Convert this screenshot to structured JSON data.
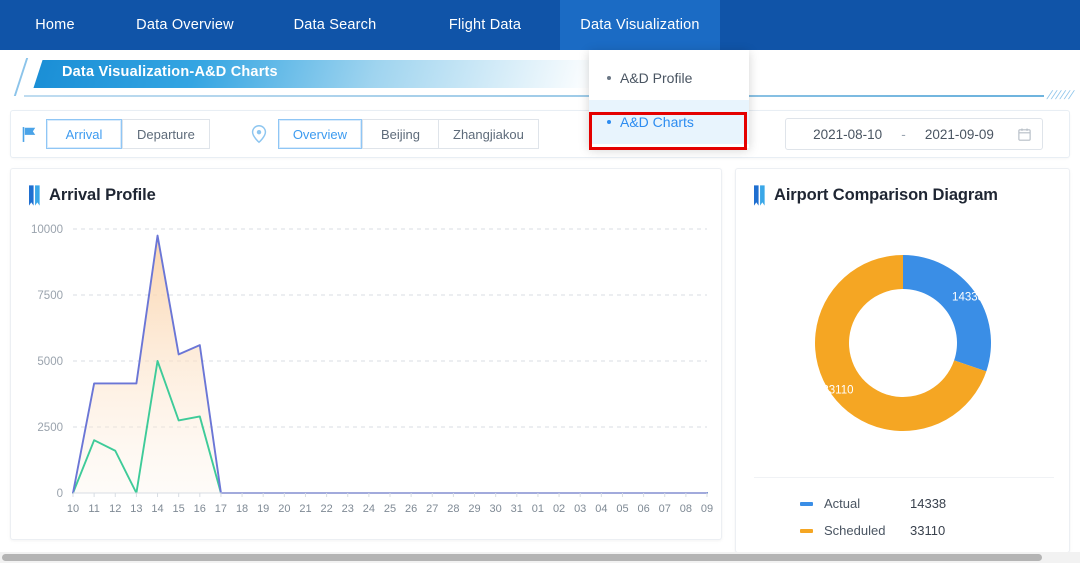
{
  "navbar": {
    "items": [
      {
        "label": "Home",
        "active": false
      },
      {
        "label": "Data Overview",
        "active": false
      },
      {
        "label": "Data Search",
        "active": false
      },
      {
        "label": "Flight Data",
        "active": false
      },
      {
        "label": "Data Visualization",
        "active": true
      }
    ],
    "background_color": "#1054a8",
    "active_color": "#1b6bc4"
  },
  "dropdown": {
    "items": [
      {
        "label": "A&D Profile",
        "selected": false
      },
      {
        "label": "A&D Charts",
        "selected": true
      }
    ],
    "highlight_color": "#e40000"
  },
  "banner": {
    "title": "Data Visualization-A&D Charts",
    "hash_marks": "//////"
  },
  "toolbar": {
    "flag_icon": "flag-icon",
    "direction_buttons": [
      {
        "label": "Arrival",
        "active": true
      },
      {
        "label": "Departure",
        "active": false
      }
    ],
    "pin_icon": "location-pin-icon",
    "location_buttons": [
      {
        "label": "Overview",
        "active": true
      },
      {
        "label": "Beijing",
        "active": false
      },
      {
        "label": "Zhangjiakou",
        "active": false
      }
    ],
    "date_range": {
      "start": "2021-08-10",
      "separator": "-",
      "end": "2021-09-09",
      "icon": "calendar-icon"
    }
  },
  "cards": {
    "left_title": "Arrival Profile",
    "right_title": "Airport Comparison Diagram"
  },
  "legend": {
    "rows": [
      {
        "name": "Actual",
        "value": "14338",
        "color": "#3a8ee6"
      },
      {
        "name": "Scheduled",
        "value": "33110",
        "color": "#f5a623"
      }
    ]
  },
  "chart_data": [
    {
      "type": "area",
      "title": "Arrival Profile",
      "xlabel": "",
      "ylabel": "",
      "ylim": [
        0,
        10000
      ],
      "yticks": [
        0,
        2500,
        5000,
        7500,
        10000
      ],
      "grid": true,
      "legend_position": "none",
      "categories": [
        "10",
        "11",
        "12",
        "13",
        "14",
        "15",
        "16",
        "17",
        "18",
        "19",
        "20",
        "21",
        "22",
        "23",
        "24",
        "25",
        "26",
        "27",
        "28",
        "29",
        "30",
        "31",
        "01",
        "02",
        "03",
        "04",
        "05",
        "06",
        "07",
        "08",
        "09"
      ],
      "series": [
        {
          "name": "Scheduled",
          "color": "#6b76d6",
          "fill": "#fbe3cd",
          "values": [
            0,
            4150,
            4150,
            4150,
            9750,
            5250,
            5600,
            0,
            0,
            0,
            0,
            0,
            0,
            0,
            0,
            0,
            0,
            0,
            0,
            0,
            0,
            0,
            0,
            0,
            0,
            0,
            0,
            0,
            0,
            0,
            0
          ]
        },
        {
          "name": "Actual",
          "color": "#3ecb99",
          "fill": "none",
          "values": [
            0,
            2000,
            1600,
            0,
            5000,
            2750,
            2900,
            0,
            0,
            0,
            0,
            0,
            0,
            0,
            0,
            0,
            0,
            0,
            0,
            0,
            0,
            0,
            0,
            0,
            0,
            0,
            0,
            0,
            0,
            0,
            0
          ]
        }
      ]
    },
    {
      "type": "pie",
      "title": "Airport Comparison Diagram",
      "donut": true,
      "legend_position": "bottom",
      "labels": [
        "Actual",
        "Scheduled"
      ],
      "values": [
        14338,
        33110
      ],
      "colors": [
        "#3a8ee6",
        "#f5a623"
      ],
      "data_labels": [
        "14338",
        "33110"
      ]
    }
  ]
}
